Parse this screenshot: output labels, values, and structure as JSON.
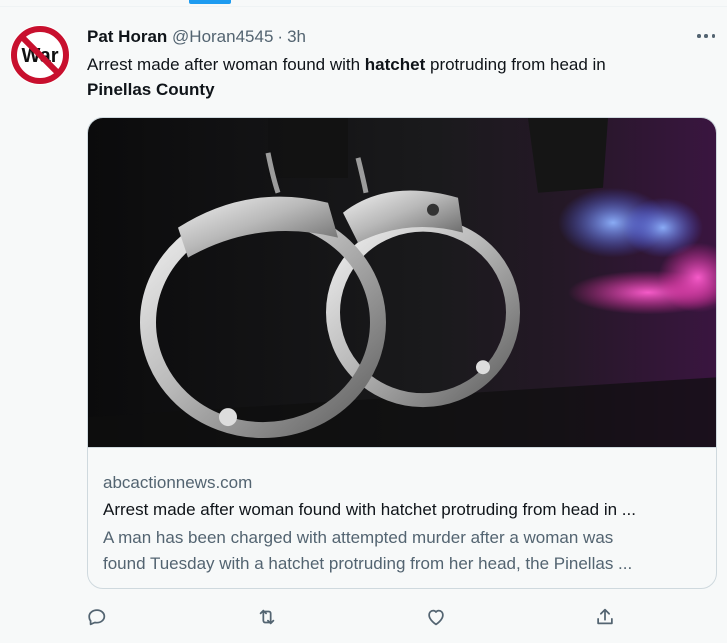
{
  "tweet": {
    "author_name": "Pat Horan",
    "handle": "@Horan4545",
    "separator": "·",
    "time": "3h",
    "avatar_text": "War",
    "text_before": "Arrest made after woman found with ",
    "text_bold_1": "hatchet",
    "text_middle": " protruding from head in ",
    "text_bold_2": "Pinellas County"
  },
  "card": {
    "domain": "abcactionnews.com",
    "title": "Arrest made after woman found with hatchet protruding from head in ...",
    "description_line_1": "A man has been charged with attempted murder after a woman was",
    "description_line_2": "found Tuesday with a hatchet protruding from her head, the Pinellas ..."
  },
  "colors": {
    "accent": "#1d9bf0",
    "text_primary": "#0f1419",
    "text_secondary": "#536471",
    "border": "#cfd9de",
    "avatar_red": "#c8102e"
  },
  "actions": [
    "reply-icon",
    "retweet-icon",
    "like-icon",
    "share-icon"
  ]
}
